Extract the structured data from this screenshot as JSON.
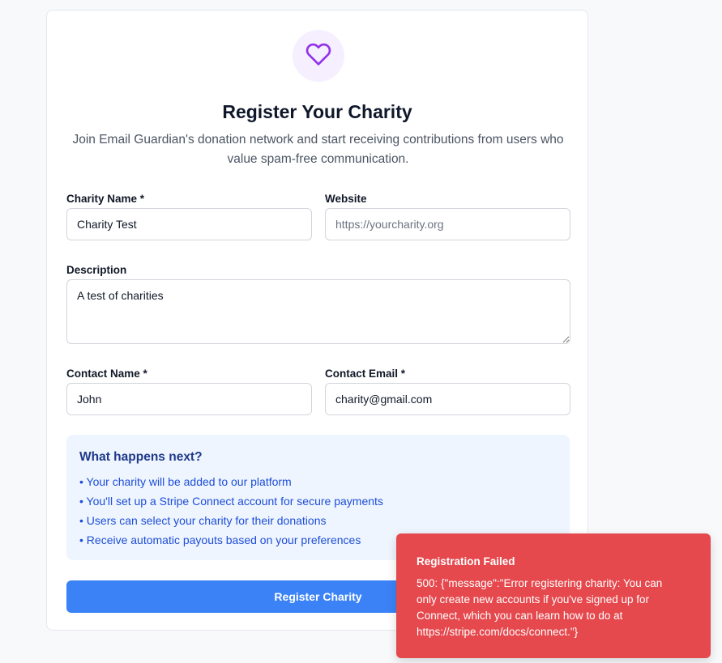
{
  "header": {
    "icon": "heart-icon",
    "title": "Register Your Charity",
    "subtitle": "Join Email Guardian's donation network and start receiving contributions from users who value spam-free communication."
  },
  "form": {
    "charity_name": {
      "label": "Charity Name *",
      "value": "Charity Test",
      "placeholder": ""
    },
    "website": {
      "label": "Website",
      "value": "",
      "placeholder": "https://yourcharity.org"
    },
    "description": {
      "label": "Description",
      "value": "A test of charities",
      "placeholder": ""
    },
    "contact_name": {
      "label": "Contact Name *",
      "value": "John",
      "placeholder": ""
    },
    "contact_email": {
      "label": "Contact Email *",
      "value": "charity@gmail.com",
      "placeholder": ""
    }
  },
  "info": {
    "title": "What happens next?",
    "items": [
      "• Your charity will be added to our platform",
      "• You'll set up a Stripe Connect account for secure payments",
      "• Users can select your charity for their donations",
      "• Receive automatic payouts based on your preferences"
    ]
  },
  "submit_label": "Register Charity",
  "toast": {
    "title": "Registration Failed",
    "message": "500: {\"message\":\"Error registering charity: You can only create new accounts if you've signed up for Connect, which you can learn how to do at https://stripe.com/docs/connect.\"}"
  },
  "colors": {
    "accent": "#3b82f6",
    "heart": "#9333ea",
    "error": "#e5484d",
    "info_bg": "#eff5fe"
  }
}
